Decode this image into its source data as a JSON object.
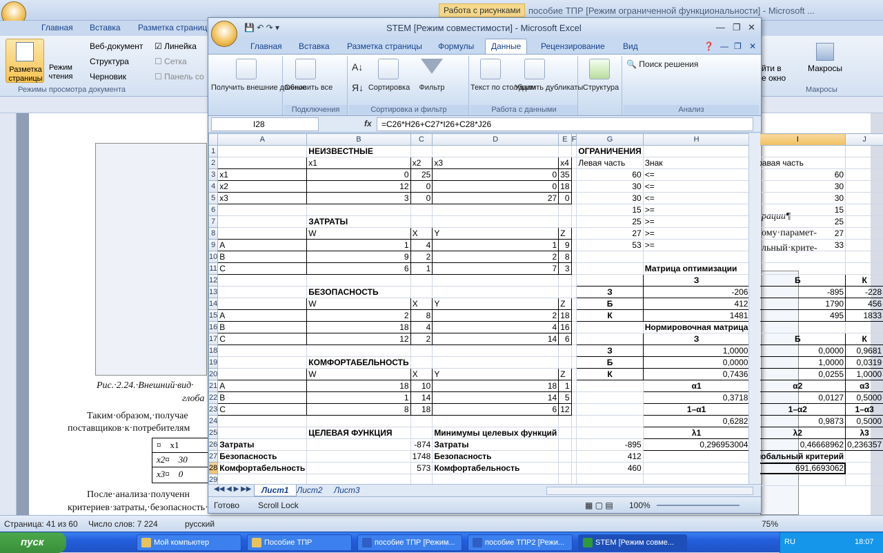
{
  "word": {
    "context_tab": "Работа с рисунками",
    "title": "пособие ТПР [Режим ограниченной функциональности] - Microsoft ...",
    "tabs": [
      "Главная",
      "Вставка",
      "Разметка страниц"
    ],
    "ribbon": {
      "layout_btn": "Разметка страницы",
      "read_btn": "Режим чтения",
      "web": "Веб-документ",
      "structure": "Структура",
      "draft": "Черновик",
      "group_label": "Режимы просмотра документа",
      "ruler": "Линейка",
      "grid": "Сетка",
      "panel": "Панель со",
      "right1": "йти в",
      "right2": "е окно",
      "macros": "Макросы",
      "macros_group": "Макросы"
    },
    "doc": {
      "caption1": "Рис.·2.24.·Внешний·вид·",
      "caption2": "глоба",
      "p1": "Таким·образом,·получае",
      "p2": "поставщиков·к·потребителям",
      "frag_right1": "рации¶",
      "frag_right2": "ому·парамет-",
      "frag_right3": "льный·крите-",
      "p3": "После·анализа·полученн",
      "p4": "критериев·затраты,·безопасность·и·комфортабельность)·делаем·вы-",
      "table_rows": [
        [
          "¤",
          "x1"
        ],
        [
          "x2¤",
          "30"
        ],
        [
          "x3¤",
          "0"
        ]
      ]
    },
    "status": {
      "page": "Страница: 41 из 60",
      "words": "Число слов: 7 224",
      "lang": "русский",
      "zoom": "75%"
    }
  },
  "excel": {
    "title": "STEM  [Режим совместимости] - Microsoft Excel",
    "tabs": [
      "Главная",
      "Вставка",
      "Разметка страницы",
      "Формулы",
      "Данные",
      "Рецензирование",
      "Вид"
    ],
    "active_tab": "Данные",
    "ribbon": {
      "get_external": "Получить внешние данные",
      "refresh_all": "Обновить все",
      "connections": "Подключения",
      "sort": "Сортировка",
      "filter": "Фильтр",
      "sort_filter": "Сортировка и фильтр",
      "text_to_cols": "Текст по столбцам",
      "remove_dups": "Удалить дубликаты",
      "data_tools": "Работа с данными",
      "outline": "Структура",
      "solver": "Поиск решения",
      "analysis": "Анализ"
    },
    "name_box": "I28",
    "fx": "fx",
    "formula": "=C26*H26+C27*I26+C28*J26",
    "columns": [
      "A",
      "B",
      "C",
      "D",
      "E",
      "F",
      "G",
      "H",
      "I",
      "J"
    ],
    "selected_col": "I",
    "selected_row": "28",
    "rows": [
      [
        "1",
        "",
        "НЕИЗВЕСТНЫЕ",
        "",
        "",
        "",
        "",
        "ОГРАНИЧЕНИЯ",
        "",
        "",
        ""
      ],
      [
        "2",
        "",
        "x1",
        "x2",
        "x3",
        "x4",
        "",
        "Левая часть",
        "Знак",
        "Правая часть",
        ""
      ],
      [
        "3",
        "x1",
        "0",
        "25",
        "0",
        "35",
        "",
        "60",
        "<=",
        "60",
        ""
      ],
      [
        "4",
        "x2",
        "12",
        "0",
        "0",
        "18",
        "",
        "30",
        "<=",
        "30",
        ""
      ],
      [
        "5",
        "x3",
        "3",
        "0",
        "27",
        "0",
        "",
        "30",
        "<=",
        "30",
        ""
      ],
      [
        "6",
        "",
        "",
        "",
        "",
        "",
        "",
        "15",
        ">=",
        "15",
        ""
      ],
      [
        "7",
        "",
        "ЗАТРАТЫ",
        "",
        "",
        "",
        "",
        "25",
        ">=",
        "25",
        ""
      ],
      [
        "8",
        "",
        "W",
        "X",
        "Y",
        "Z",
        "",
        "27",
        ">=",
        "27",
        ""
      ],
      [
        "9",
        "A",
        "1",
        "4",
        "1",
        "9",
        "",
        "53",
        ">=",
        "33",
        ""
      ],
      [
        "10",
        "B",
        "9",
        "2",
        "2",
        "8",
        "",
        "",
        "",
        "",
        ""
      ],
      [
        "11",
        "C",
        "6",
        "1",
        "7",
        "3",
        "",
        "",
        "Матрица оптимизации",
        "",
        ""
      ],
      [
        "12",
        "",
        "",
        "",
        "",
        "",
        "",
        "",
        "З",
        "Б",
        "К"
      ],
      [
        "13",
        "",
        "БЕЗОПАСНОСТЬ",
        "",
        "",
        "",
        "",
        "З",
        "-206",
        "-895",
        "-228"
      ],
      [
        "14",
        "",
        "W",
        "X",
        "Y",
        "Z",
        "",
        "Б",
        "412",
        "1790",
        "456"
      ],
      [
        "15",
        "A",
        "2",
        "8",
        "2",
        "18",
        "",
        "К",
        "1481",
        "495",
        "1833"
      ],
      [
        "16",
        "B",
        "18",
        "4",
        "4",
        "16",
        "",
        "",
        "Нормировочная матрица",
        "",
        ""
      ],
      [
        "17",
        "C",
        "12",
        "2",
        "14",
        "6",
        "",
        "",
        "З",
        "Б",
        "К"
      ],
      [
        "18",
        "",
        "",
        "",
        "",
        "",
        "",
        "З",
        "1,0000",
        "0,0000",
        "0,9681"
      ],
      [
        "19",
        "",
        "КОМФОРТАБЕЛЬНОСТЬ",
        "",
        "",
        "",
        "",
        "Б",
        "0,0000",
        "1,0000",
        "0,0319"
      ],
      [
        "20",
        "",
        "W",
        "X",
        "Y",
        "Z",
        "",
        "К",
        "0,7436",
        "0,0255",
        "1,0000"
      ],
      [
        "21",
        "A",
        "18",
        "10",
        "18",
        "1",
        "",
        "",
        "α1",
        "α2",
        "α3"
      ],
      [
        "22",
        "B",
        "1",
        "14",
        "14",
        "5",
        "",
        "",
        "0,3718",
        "0,0127",
        "0,5000"
      ],
      [
        "23",
        "C",
        "8",
        "18",
        "6",
        "12",
        "",
        "",
        "1–α1",
        "1–α2",
        "1–α3"
      ],
      [
        "24",
        "",
        "",
        "",
        "",
        "",
        "",
        "",
        "0,6282",
        "0,9873",
        "0,5000"
      ],
      [
        "25",
        "",
        "ЦЕЛЕВАЯ ФУНКЦИЯ",
        "",
        "Минимумы целевых функций",
        "",
        "",
        "",
        "λ1",
        "λ2",
        "λ3"
      ],
      [
        "26",
        "Затраты",
        "",
        "-874",
        "Затраты",
        "",
        "",
        "-895",
        "0,296953004",
        "0,46668962",
        "0,236357"
      ],
      [
        "27",
        "Безопасность",
        "",
        "1748",
        "Безопасность",
        "",
        "",
        "412",
        "",
        "Глобальный критерий",
        ""
      ],
      [
        "28",
        "Комфортабельность",
        "",
        "573",
        "Комфортабельность",
        "",
        "",
        "460",
        "",
        "691,6693062",
        ""
      ],
      [
        "29",
        "",
        "",
        "",
        "",
        "",
        "",
        "",
        "",
        "",
        ""
      ]
    ],
    "sheets": [
      "Лист1",
      "Лист2",
      "Лист3"
    ],
    "active_sheet": "Лист1",
    "status_ready": "Готово",
    "status_scroll": "Scroll Lock",
    "zoom": "100%"
  },
  "taskbar": {
    "start": "пуск",
    "items": [
      "Мой компьютер",
      "Пособие ТПР",
      "пособие ТПР [Режим...",
      "пособие ТПР2 [Режи...",
      "STEM  [Режим совме..."
    ],
    "lang": "RU",
    "clock": "18:07"
  }
}
